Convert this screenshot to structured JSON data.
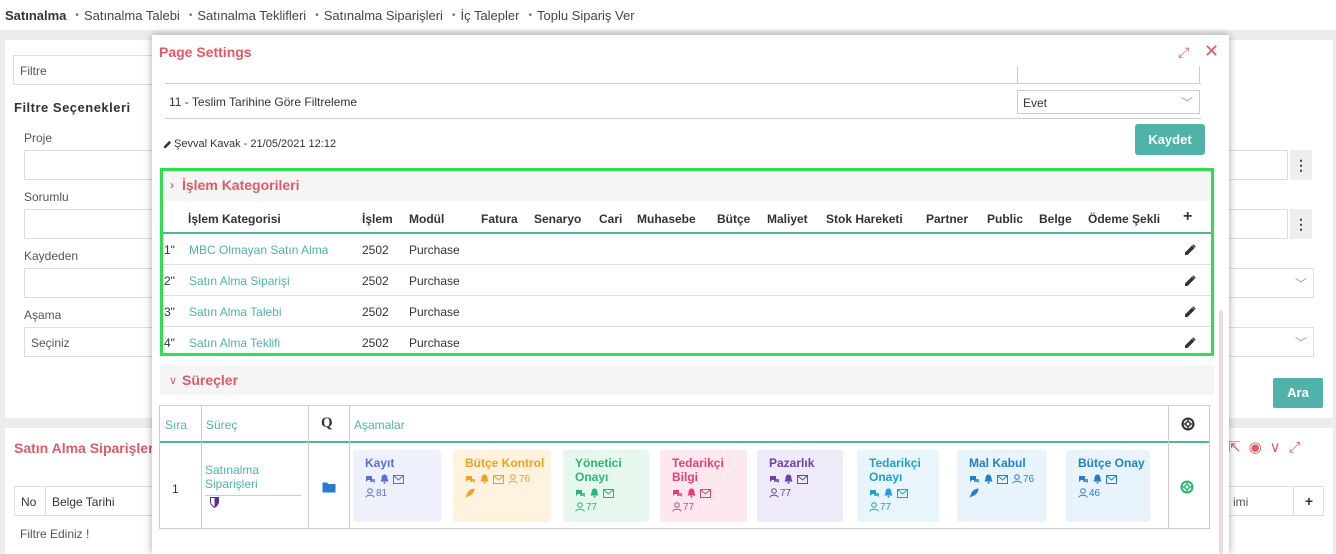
{
  "topnav": {
    "items": [
      "Satınalma",
      "Satınalma Talebi",
      "Satınalma Teklifleri",
      "Satınalma Siparişleri",
      "İç Talepler",
      "Toplu Sipariş Ver"
    ]
  },
  "background": {
    "filter_placeholder": "Filtre",
    "filter_options_title": "Filtre Seçenekleri",
    "labels": {
      "proje": "Proje",
      "sorumlu": "Sorumlu",
      "kaydeden": "Kaydeden",
      "asama": "Aşama"
    },
    "asama_value": "Seçiniz",
    "search_button": "Ara",
    "orders_title": "Satın Alma Siparişleri",
    "orders_columns": [
      "No",
      "Belge Tarihi"
    ],
    "orders_right_col": "imi",
    "empty_message": "Filtre Ediniz !"
  },
  "modal": {
    "title": "Page Settings",
    "setting": {
      "label": "11 - Teslim Tarihine Göre Filtreleme",
      "value": "Evet"
    },
    "author": "Şevval Kavak - 21/05/2021 12:12",
    "save_button": "Kaydet",
    "categories": {
      "title": "İşlem Kategorileri",
      "columns": [
        "İşlem Kategorisi",
        "İşlem",
        "Modül",
        "Fatura",
        "Senaryo",
        "Cari",
        "Muhasebe",
        "Bütçe",
        "Maliyet",
        "Stok Hareketi",
        "Partner",
        "Public",
        "Belge",
        "Ödeme Şekli"
      ],
      "add": "+",
      "rows": [
        {
          "no": "1\"",
          "name": "MBC Olmayan Satın Alma",
          "islem": "2502",
          "modul": "Purchase"
        },
        {
          "no": "2\"",
          "name": "Satın Alma Siparişi",
          "islem": "2502",
          "modul": "Purchase"
        },
        {
          "no": "3\"",
          "name": "Satın Alma Talebi",
          "islem": "2502",
          "modul": "Purchase"
        },
        {
          "no": "4\"",
          "name": "Satın Alma Teklifi",
          "islem": "2502",
          "modul": "Purchase"
        }
      ]
    },
    "processes": {
      "title": "Süreçler",
      "columns": {
        "sira": "Sıra",
        "surec": "Süreç",
        "q": "Q",
        "asamalar": "Aşamalar"
      },
      "row": {
        "sira": "1",
        "name": "Satınalma Siparişleri",
        "stages": [
          {
            "name": "Kayıt",
            "count": "81",
            "color": "#5a6fd0",
            "bg": "#eef0fb"
          },
          {
            "name": "Bütçe Kontrol",
            "count": "76",
            "color": "#f0a020",
            "bg": "#fff3e0"
          },
          {
            "name": "Yönetici Onayı",
            "count": "77",
            "color": "#2bb673",
            "bg": "#e6f7ee"
          },
          {
            "name": "Tedarikçi Bilgi",
            "count": "77",
            "color": "#e0407a",
            "bg": "#fde8ef"
          },
          {
            "name": "Pazarlık",
            "count": "77",
            "color": "#6a3fb0",
            "bg": "#efeaf7"
          },
          {
            "name": "Tedarikçi Onayı",
            "count": "77",
            "color": "#20a0c8",
            "bg": "#e8f6fb"
          },
          {
            "name": "Mal Kabul",
            "count": "76",
            "color": "#2080d0",
            "bg": "#e8f3fb"
          },
          {
            "name": "Bütçe Onay",
            "count": "46",
            "color": "#2080d0",
            "bg": "#e8f3fb"
          }
        ]
      }
    }
  }
}
